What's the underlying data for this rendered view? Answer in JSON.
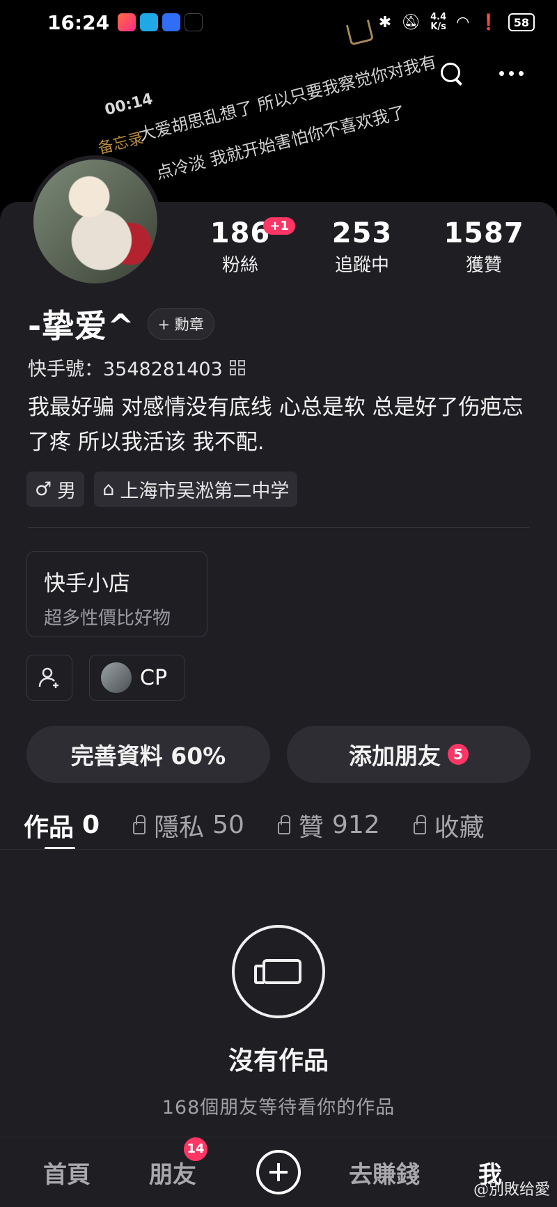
{
  "status_bar": {
    "time": "16:24",
    "net_speed_value": "4.4",
    "net_speed_unit": "K/s",
    "battery": "58"
  },
  "banner": {
    "time": "00:14",
    "memo": "备忘录",
    "line1": "大爱胡思乱想了 所以只要我察觉你对我有",
    "line2": "点冷淡 我就开始害怕你不喜欢我了"
  },
  "profile": {
    "username": "-挚爱^",
    "medal_button": "+ 勳章",
    "id_label": "快手號：3548281403",
    "bio": "我最好骗 对感情没有底线 心总是软 总是好了伤疤忘了疼 所以我活该 我不配.",
    "tags": [
      {
        "icon": "male-icon",
        "label": "男",
        "symbol": "♂"
      },
      {
        "icon": "school-icon",
        "label": "上海市吴淞第二中学",
        "symbol": "⌂"
      }
    ]
  },
  "stats": [
    {
      "value": "186",
      "label": "粉絲",
      "badge": "+1"
    },
    {
      "value": "253",
      "label": "追蹤中"
    },
    {
      "value": "1587",
      "label": "獲贊"
    }
  ],
  "shop": {
    "title": "快手小店",
    "subtitle": "超多性價比好物"
  },
  "cp_label": "CP",
  "actions": {
    "complete_profile": "完善資料 60%",
    "add_friends": "添加朋友",
    "add_friends_badge": "5"
  },
  "tabs": [
    {
      "label": "作品",
      "count": "0",
      "locked": false,
      "active": true
    },
    {
      "label": "隱私",
      "count": "50",
      "locked": true
    },
    {
      "label": "贊",
      "count": "912",
      "locked": true
    },
    {
      "label": "收藏",
      "count": "",
      "locked": true
    }
  ],
  "empty_state": {
    "title": "沒有作品",
    "subtitle": "168個朋友等待看你的作品"
  },
  "bottom_nav": {
    "home": "首頁",
    "friends": "朋友",
    "friends_badge": "14",
    "earn": "去賺錢",
    "me": "我"
  },
  "watermark": "@別敗给愛",
  "colors": {
    "accent": "#fe3666",
    "background": "#1f1e23"
  }
}
